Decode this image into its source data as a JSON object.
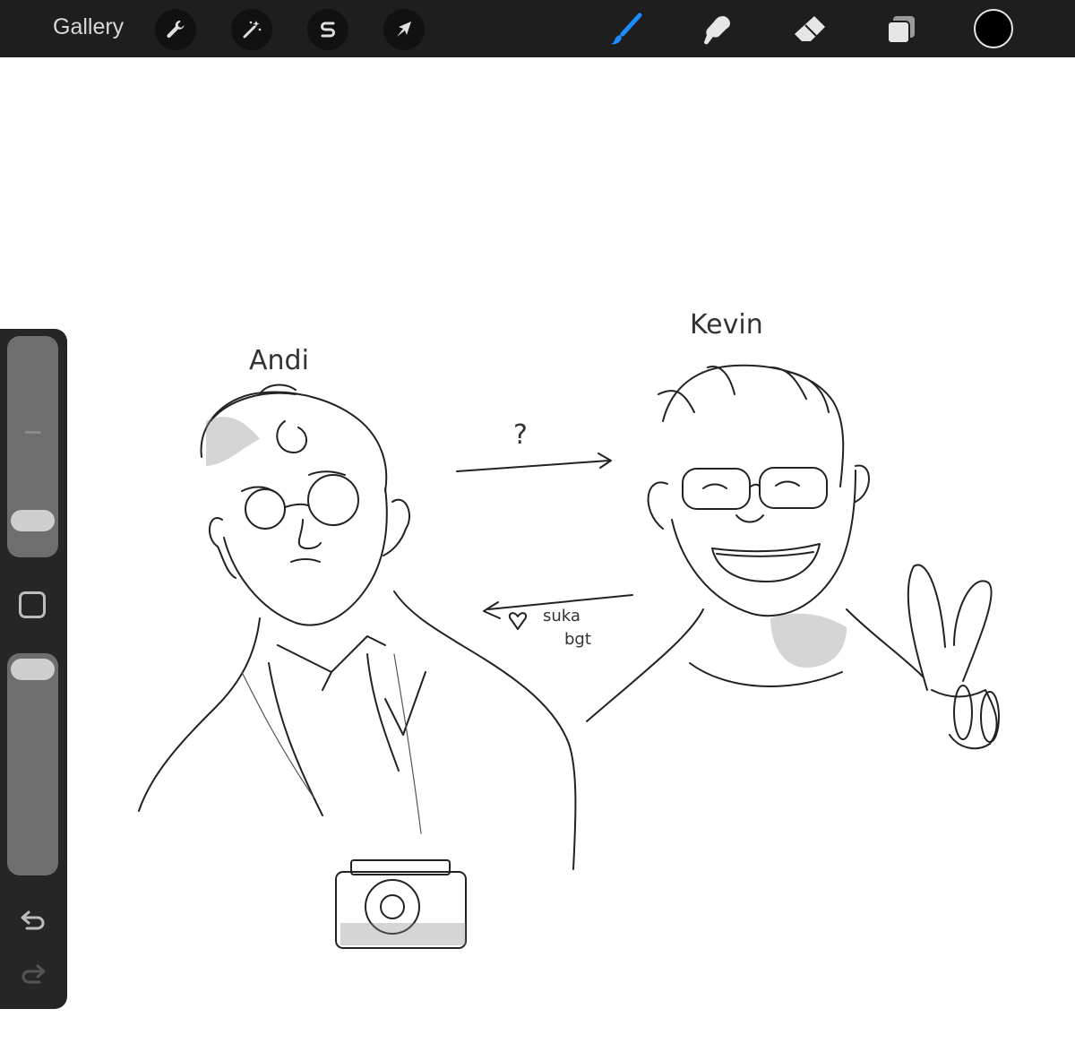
{
  "toolbar": {
    "gallery_label": "Gallery",
    "left_tools": [
      {
        "name": "actions",
        "icon": "wrench-icon"
      },
      {
        "name": "adjustments",
        "icon": "magic-wand-icon"
      },
      {
        "name": "selection",
        "icon": "selection-s-icon"
      },
      {
        "name": "transform",
        "icon": "arrow-cursor-icon"
      }
    ],
    "right_tools": [
      {
        "name": "brush",
        "icon": "brush-icon",
        "active": true,
        "color": "#1a8cff"
      },
      {
        "name": "smudge",
        "icon": "smudge-icon",
        "active": false
      },
      {
        "name": "eraser",
        "icon": "eraser-icon",
        "active": false
      },
      {
        "name": "layers",
        "icon": "layers-icon",
        "active": false
      }
    ],
    "current_color": "#000000"
  },
  "sidebar": {
    "brush_size_level": 0.75,
    "brush_opacity_level": 0.05,
    "modify_icon": "square-icon",
    "undo_icon": "undo-icon",
    "redo_icon": "redo-icon"
  },
  "canvas": {
    "labels": {
      "left_name": "Andi",
      "right_name": "Kevin",
      "question_mark": "?",
      "note_line1": "suka",
      "note_line2": "bgt"
    }
  }
}
